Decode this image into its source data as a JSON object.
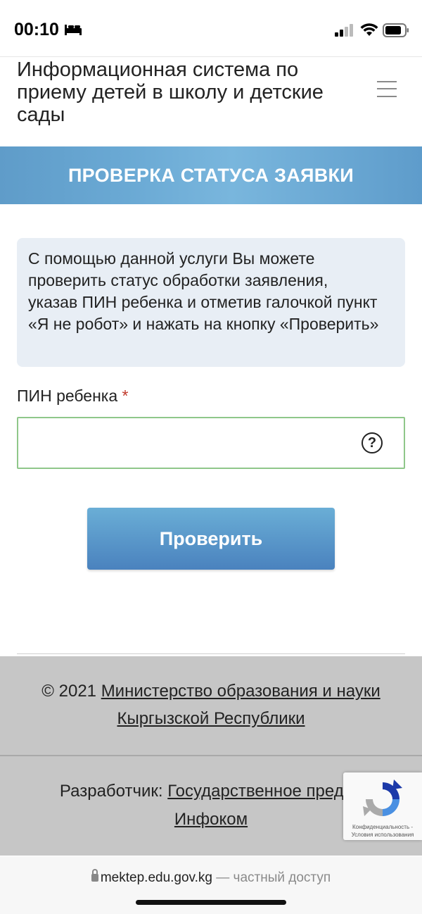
{
  "status_bar": {
    "time": "00:10"
  },
  "header": {
    "title": "Информационная система по приему детей в школу и детские сады"
  },
  "banner": {
    "title": "ПРОВЕРКА СТАТУСА ЗАЯВКИ"
  },
  "info": {
    "text": "С помощью данной услуги Вы можете проверить статус обработки заявления, указав ПИН ребенка и отметив галочкой пункт «Я не робот» и нажать на кнопку «Проверить»"
  },
  "form": {
    "pin_label": "ПИН ребенка",
    "required_mark": "*",
    "pin_value": "",
    "help_symbol": "?",
    "submit_label": "Проверить"
  },
  "footer": {
    "copyright_prefix": "© 2021",
    "ministry_link": "Министерство образования и науки Кыргызской Республики",
    "developer_prefix": "Разработчик:",
    "developer_link_line1": "Государственное предпр",
    "developer_link_line2": "Инфоком"
  },
  "recaptcha": {
    "terms": "Конфиденциальность - Условия использования"
  },
  "browser": {
    "url": "mektep.edu.gov.kg",
    "url_note": "— частный доступ"
  },
  "colors": {
    "banner": "#6aa9d4",
    "button": "#4a82be",
    "footer": "#c6c6c6",
    "field_border": "#8fc78a",
    "info_bg": "#e8eef5"
  }
}
